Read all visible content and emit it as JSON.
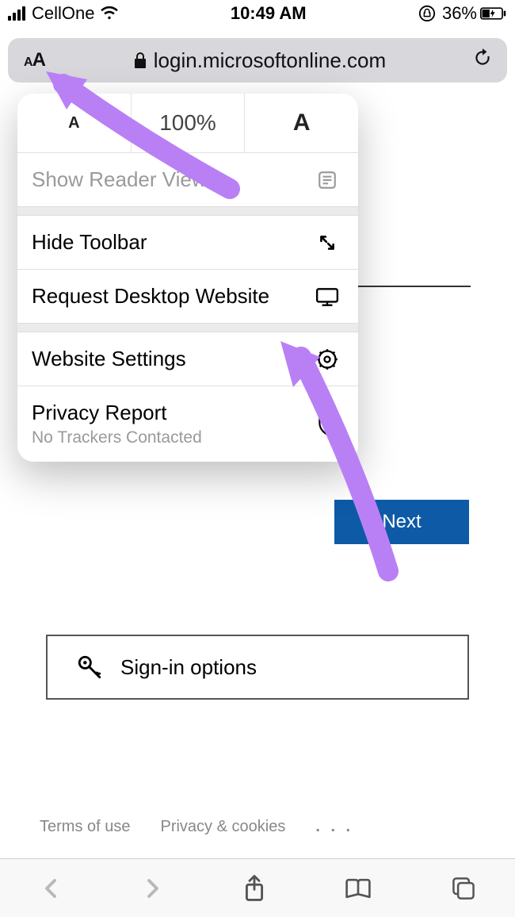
{
  "status": {
    "carrier": "CellOne",
    "time": "10:49 AM",
    "battery_percent": "36%"
  },
  "urlbar": {
    "domain": "login.microsoftonline.com"
  },
  "popover": {
    "zoom": {
      "decrease_glyph": "A",
      "increase_glyph": "A",
      "current": "100%"
    },
    "reader_label": "Show Reader View",
    "hide_toolbar_label": "Hide Toolbar",
    "request_desktop_label": "Request Desktop Website",
    "website_settings_label": "Website Settings",
    "privacy_report_label": "Privacy Report",
    "privacy_report_sub": "No Trackers Contacted"
  },
  "page": {
    "next_label": "Next",
    "signin_options_label": "Sign-in options"
  },
  "footer": {
    "terms": "Terms of use",
    "privacy": "Privacy & cookies",
    "more": ". . ."
  }
}
